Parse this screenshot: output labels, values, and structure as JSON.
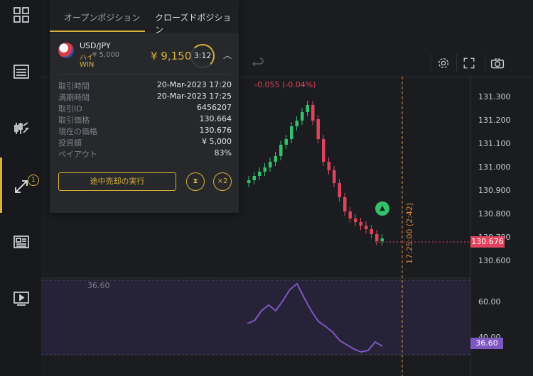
{
  "sidebar": {
    "icons": [
      "grid-icon",
      "chart-list-icon",
      "trade-arrows-icon",
      "positions-swap-icon",
      "news-icon",
      "video-icon"
    ],
    "positions_badge": "1"
  },
  "chart": {
    "change_text": "-0.055 (-0.04%)",
    "price_labels": [
      "131.300",
      "131.200",
      "131.100",
      "131.000",
      "130.900",
      "130.800",
      "130.700",
      "130.600"
    ],
    "current_price": "130.676",
    "rsi_labels": [
      "60.00",
      "40.00"
    ],
    "rsi_value": "36.60",
    "rsi_top_label": "36.60",
    "timer_vertical": "17:25:00 (2:42)",
    "colors": {
      "up": "#33c26b",
      "down": "#e0445c",
      "rsi": "#7e57c2",
      "accent": "#d6b23b"
    }
  },
  "panel": {
    "tab_open": "オープンポジション",
    "tab_closed": "クローズドポジション",
    "pair": "USD/JPY",
    "direction": "ハイ",
    "amount": "¥ 5,000",
    "status": "WIN",
    "payout": "¥ 9,150",
    "timer": "3:12",
    "details": [
      {
        "label": "取引時間",
        "value": "20-Mar-2023 17:20"
      },
      {
        "label": "満期時間",
        "value": "20-Mar-2023 17:25"
      },
      {
        "label": "取引ID",
        "value": "6456207"
      },
      {
        "label": "取引価格",
        "value": "130.664"
      },
      {
        "label": "現在の価格",
        "value": "130.676"
      },
      {
        "label": "投資額",
        "value": "¥ 5,000"
      },
      {
        "label": "ペイアウト",
        "value": "83%"
      }
    ],
    "sell_button": "途中売却の実行",
    "double_button": "×2"
  }
}
